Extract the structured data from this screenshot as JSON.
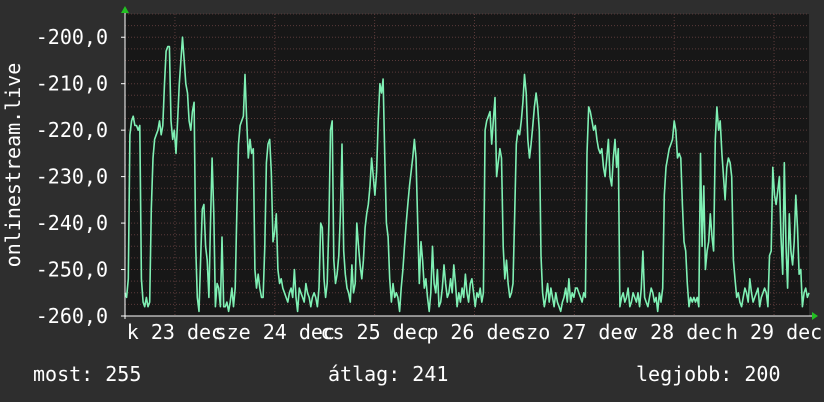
{
  "chart_data": {
    "type": "line",
    "ylabel": "onlinestream.live",
    "ylim": [
      -260,
      -195
    ],
    "y_ticks": [
      -260,
      -250,
      -240,
      -230,
      -220,
      -210,
      -200
    ],
    "y_tick_labels": [
      "-260,0",
      "-250,0",
      "-240,0",
      "-230,0",
      "-220,0",
      "-210,0",
      "-200,0"
    ],
    "x_tick_labels": [
      "k 23 dec",
      "sze 24 dec",
      "cs 25 dec",
      "p 26 dec",
      "szo 27 dec",
      "v 28 dec",
      "h 29 dec"
    ],
    "grid": true,
    "series": [
      {
        "color": "#7ff0b4",
        "values": [
          -255,
          -256,
          -252,
          -221,
          -218,
          -217,
          -219,
          -219,
          -220,
          -219,
          -252,
          -257,
          -258,
          -256,
          -258,
          -257,
          -237,
          -226,
          -222,
          -221,
          -220,
          -218,
          -221,
          -219,
          -210,
          -203,
          -202,
          -202,
          -218,
          -222,
          -220,
          -225,
          -218,
          -210,
          -205,
          -200,
          -205,
          -210,
          -212,
          -218,
          -220,
          -216,
          -214,
          -245,
          -256,
          -259,
          -248,
          -237,
          -236,
          -245,
          -248,
          -256,
          -240,
          -226,
          -238,
          -258,
          -253,
          -254,
          -258,
          -243,
          -258,
          -258,
          -257,
          -259,
          -257,
          -254,
          -258,
          -254,
          -238,
          -223,
          -219,
          -218,
          -217,
          -208,
          -218,
          -226,
          -222,
          -225,
          -224,
          -250,
          -254,
          -251,
          -254,
          -256,
          -256,
          -245,
          -227,
          -223,
          -222,
          -229,
          -244,
          -242,
          -238,
          -250,
          -253,
          -252,
          -254,
          -255,
          -256,
          -257,
          -255,
          -254,
          -256,
          -250,
          -256,
          -259,
          -254,
          -255,
          -256,
          -257,
          -253,
          -255,
          -256,
          -258,
          -256,
          -255,
          -256,
          -258,
          -254,
          -240,
          -241,
          -252,
          -256,
          -253,
          -240,
          -220,
          -218,
          -248,
          -253,
          -251,
          -247,
          -238,
          -223,
          -246,
          -251,
          -254,
          -255,
          -257,
          -249,
          -255,
          -253,
          -240,
          -245,
          -249,
          -252,
          -248,
          -241,
          -238,
          -236,
          -232,
          -226,
          -230,
          -234,
          -229,
          -218,
          -210,
          -212,
          -209,
          -226,
          -240,
          -243,
          -252,
          -257,
          -253,
          -256,
          -255,
          -256,
          -259,
          -254,
          -250,
          -245,
          -240,
          -236,
          -232,
          -229,
          -226,
          -222,
          -226,
          -240,
          -253,
          -244,
          -248,
          -254,
          -252,
          -256,
          -259,
          -255,
          -245,
          -253,
          -255,
          -250,
          -258,
          -257,
          -254,
          -249,
          -253,
          -256,
          -255,
          -252,
          -255,
          -249,
          -253,
          -258,
          -255,
          -257,
          -254,
          -256,
          -251,
          -255,
          -257,
          -253,
          -252,
          -255,
          -258,
          -255,
          -256,
          -254,
          -257,
          -255,
          -220,
          -218,
          -217,
          -216,
          -223,
          -218,
          -213,
          -230,
          -227,
          -224,
          -226,
          -245,
          -252,
          -248,
          -253,
          -256,
          -255,
          -253,
          -238,
          -223,
          -220,
          -221,
          -218,
          -214,
          -208,
          -212,
          -222,
          -226,
          -223,
          -219,
          -215,
          -212,
          -215,
          -220,
          -247,
          -255,
          -258,
          -256,
          -253,
          -257,
          -254,
          -256,
          -258,
          -255,
          -257,
          -258,
          -259,
          -257,
          -256,
          -254,
          -257,
          -252,
          -257,
          -255,
          -256,
          -254,
          -254,
          -255,
          -256,
          -257,
          -255,
          -256,
          -225,
          -215,
          -216,
          -218,
          -220,
          -219,
          -222,
          -224,
          -225,
          -224,
          -228,
          -230,
          -226,
          -222,
          -230,
          -232,
          -226,
          -222,
          -228,
          -224,
          -258,
          -256,
          -255,
          -257,
          -256,
          -254,
          -258,
          -257,
          -255,
          -256,
          -257,
          -255,
          -258,
          -254,
          -246,
          -256,
          -257,
          -258,
          -256,
          -254,
          -255,
          -257,
          -256,
          -259,
          -255,
          -257,
          -254,
          -234,
          -228,
          -226,
          -224,
          -223,
          -222,
          -218,
          -220,
          -226,
          -225,
          -226,
          -236,
          -244,
          -246,
          -253,
          -258,
          -256,
          -257,
          -256,
          -257,
          -256,
          -258,
          -225,
          -245,
          -232,
          -250,
          -246,
          -244,
          -238,
          -243,
          -246,
          -222,
          -215,
          -220,
          -218,
          -225,
          -230,
          -235,
          -228,
          -226,
          -227,
          -230,
          -248,
          -252,
          -256,
          -255,
          -257,
          -258,
          -256,
          -254,
          -255,
          -257,
          -252,
          -255,
          -257,
          -256,
          -255,
          -254,
          -258,
          -256,
          -255,
          -254,
          -255,
          -258,
          -247,
          -246,
          -228,
          -234,
          -236,
          -233,
          -230,
          -243,
          -251,
          -227,
          -245,
          -254,
          -238,
          -246,
          -249,
          -244,
          -234,
          -241,
          -251,
          -250,
          -258,
          -255,
          -254,
          -256,
          -255
        ]
      }
    ]
  },
  "stats": {
    "current_label": "most: 255",
    "average_label": "átlag: 241",
    "best_label": "legjobb: 200"
  },
  "colors": {
    "background": "#2e2e2e",
    "plot_background": "#171717",
    "series_line": "#7ff0b4",
    "grid_line": "#5a3a3a",
    "axis_arrow": "#22c022"
  }
}
